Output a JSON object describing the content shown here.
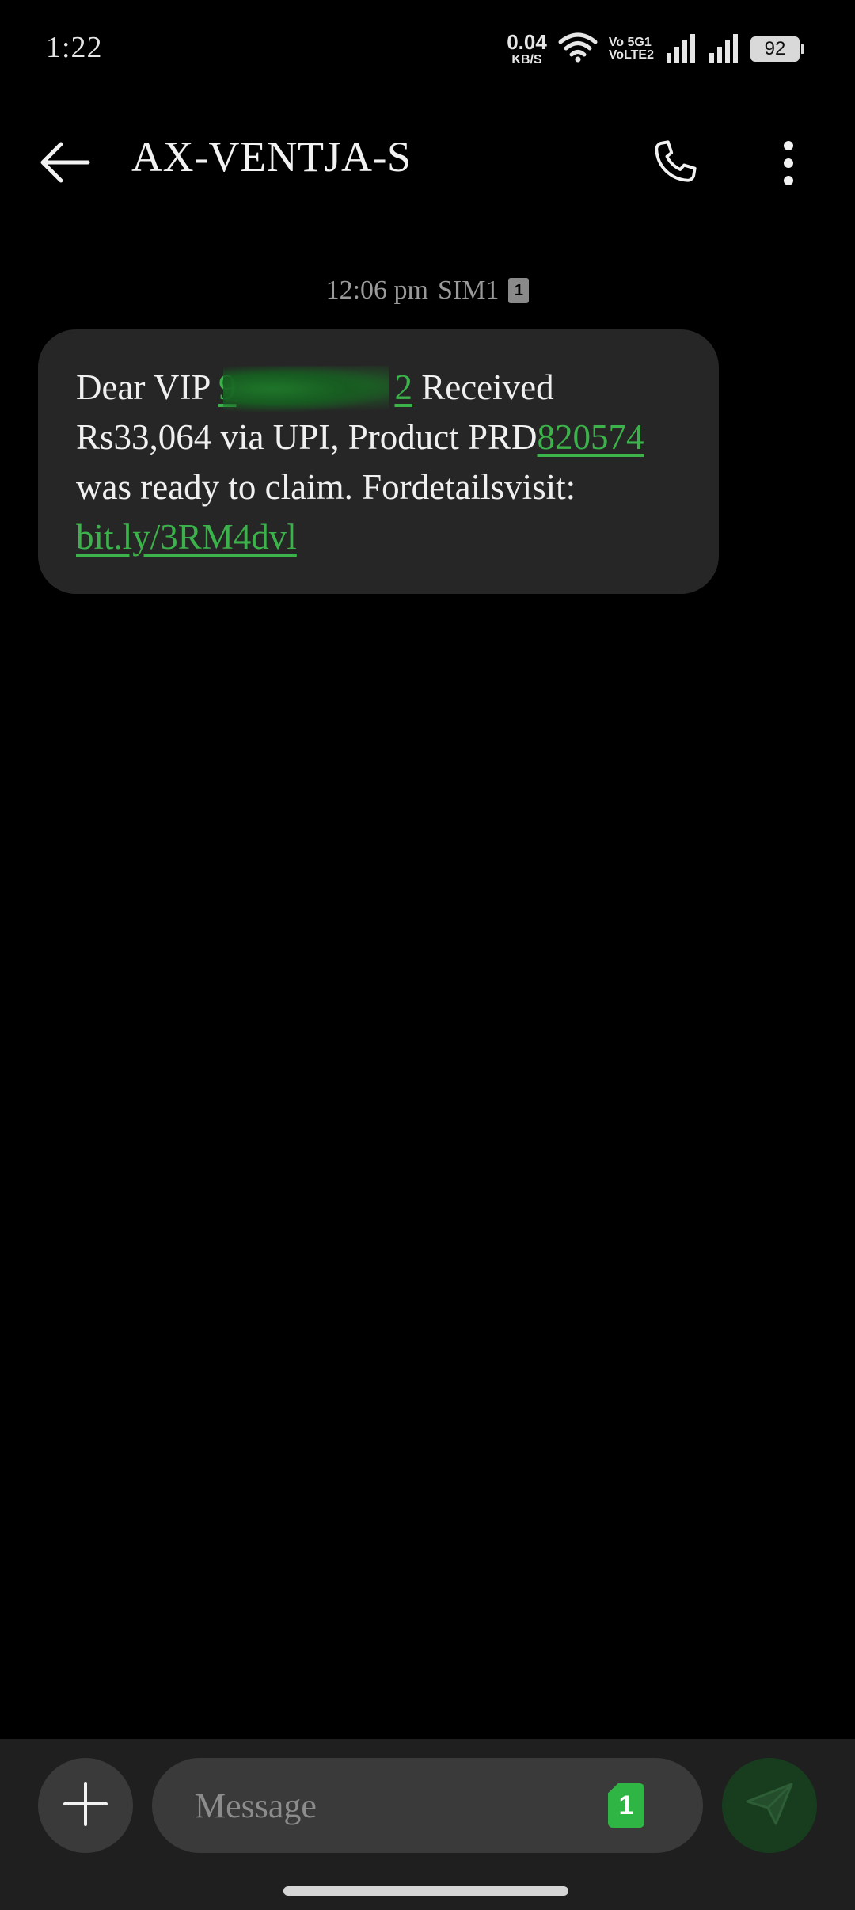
{
  "status_bar": {
    "time": "1:22",
    "net_speed_value": "0.04",
    "net_speed_unit": "KB/S",
    "volte_line1": "Vo 5G1",
    "volte_line2": "VoLTE2",
    "battery": "92",
    "icons": [
      "wifi-icon",
      "signal-sim1-icon",
      "signal-sim2-icon",
      "battery-icon"
    ]
  },
  "app_bar": {
    "title": "AX-VENTJA-S",
    "icons": [
      "back-arrow-icon",
      "phone-icon",
      "more-vert-icon"
    ]
  },
  "conversation": {
    "timestamp": "12:06 pm",
    "sim_label": "SIM1",
    "sim_number": "1",
    "message": {
      "part1": "Dear VIP ",
      "redacted_number": "9",
      "redacted_tail": "2",
      "part2": " Received Rs33,064 via UPI, Product PRD",
      "product_code": "820574",
      "part3": " was ready to claim. Fordetailsvisit: ",
      "link": "bit.ly/3RM4dvl"
    }
  },
  "compose": {
    "placeholder": "Message",
    "sim_number": "1",
    "icons": [
      "plus-icon",
      "sim-select-icon",
      "send-icon"
    ]
  },
  "colors": {
    "background": "#000000",
    "bubble": "#262626",
    "link": "#3bb34a",
    "compose_bar": "#1f1f1f",
    "send_button": "#173d1e"
  }
}
